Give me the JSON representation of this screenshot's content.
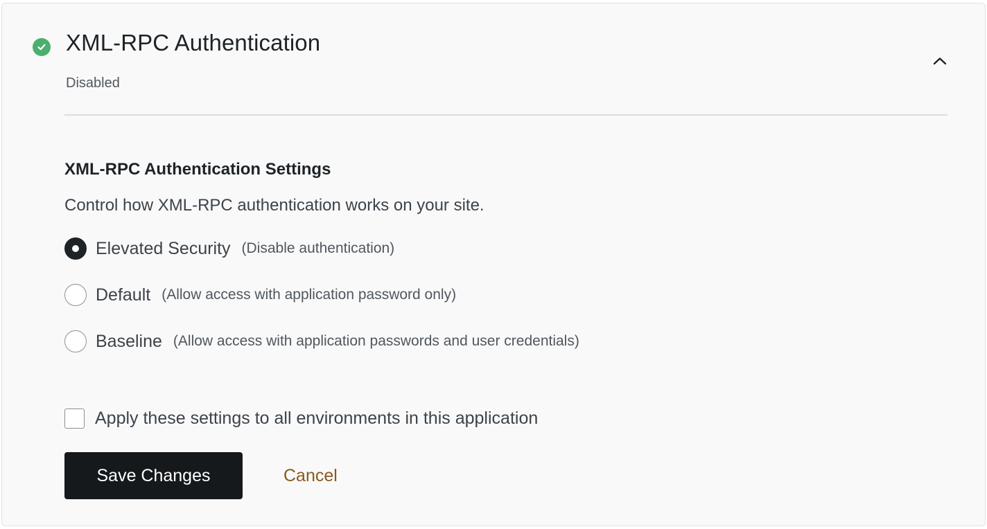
{
  "header": {
    "title": "XML-RPC Authentication",
    "status_text": "Disabled",
    "status_icon": "check-circle-icon",
    "collapse_icon": "chevron-up-icon",
    "status_color": "#4caf6e"
  },
  "settings": {
    "heading": "XML-RPC Authentication Settings",
    "description": "Control how XML-RPC authentication works on your site.",
    "options": [
      {
        "label": "Elevated Security",
        "hint": "(Disable authentication)",
        "selected": true
      },
      {
        "label": "Default",
        "hint": "(Allow access with application password only)",
        "selected": false
      },
      {
        "label": "Baseline",
        "hint": "(Allow access with application passwords and user credentials)",
        "selected": false
      }
    ],
    "apply_all_label": "Apply these settings to all environments in this application",
    "apply_all_checked": false
  },
  "actions": {
    "save_label": "Save Changes",
    "cancel_label": "Cancel",
    "primary_color": "#15191c",
    "link_color": "#8a5a1c"
  }
}
